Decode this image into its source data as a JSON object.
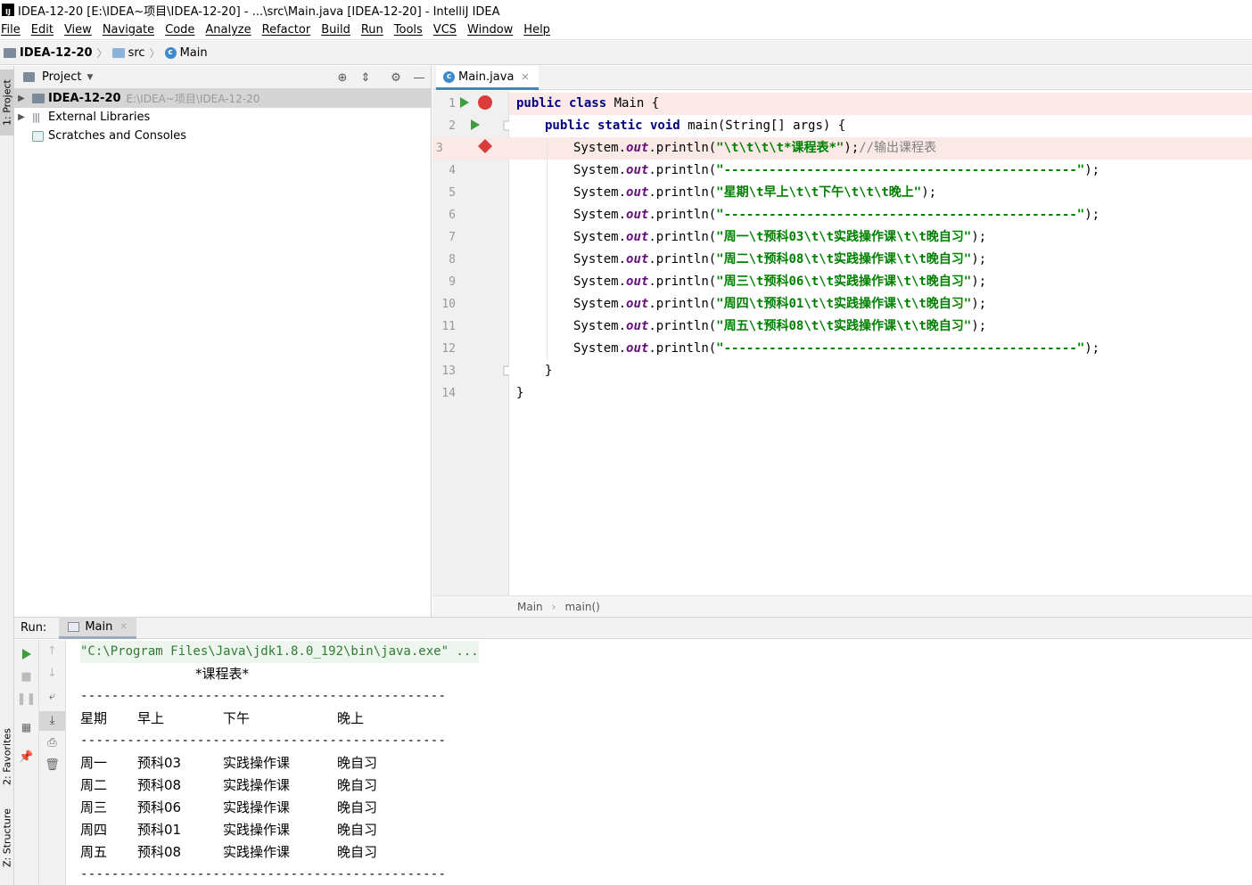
{
  "window": {
    "title": "IDEA-12-20 [E:\\IDEA~项目\\IDEA-12-20] - ...\\src\\Main.java [IDEA-12-20] - IntelliJ IDEA",
    "logo": "IJ"
  },
  "menu": [
    "File",
    "Edit",
    "View",
    "Navigate",
    "Code",
    "Analyze",
    "Refactor",
    "Build",
    "Run",
    "Tools",
    "VCS",
    "Window",
    "Help"
  ],
  "breadcrumb": {
    "project": "IDEA-12-20",
    "folder": "src",
    "file": "Main"
  },
  "side_tabs": {
    "project": "1: Project",
    "favorites": "2: Favorites",
    "structure": "Z: Structure"
  },
  "project_panel": {
    "title": "Project",
    "tree": [
      {
        "label": "IDEA-12-20",
        "path": "E:\\IDEA~项目\\IDEA-12-20",
        "selected": true
      },
      {
        "label": "External Libraries"
      },
      {
        "label": "Scratches and Consoles"
      }
    ]
  },
  "editor": {
    "tab": "Main.java",
    "line_numbers": [
      "1",
      "2",
      "3",
      "4",
      "5",
      "6",
      "7",
      "8",
      "9",
      "10",
      "11",
      "12",
      "13",
      "14"
    ],
    "lines": [
      {
        "kw": "public class ",
        "rest": "Main {"
      },
      {
        "kw": "public static void ",
        "rest": "main(String[] args) {"
      },
      {
        "pre": "System.",
        "field": "out",
        "mid": ".println(",
        "str": "\"\\t\\t\\t\\t*课程表*\"",
        "post": ");",
        "comment": "//输出课程表"
      },
      {
        "pre": "System.",
        "field": "out",
        "mid": ".println(",
        "str": "\"-----------------------------------------------\"",
        "post": ");"
      },
      {
        "pre": "System.",
        "field": "out",
        "mid": ".println(",
        "str": "\"星期\\t早上\\t\\t下午\\t\\t\\t晚上\"",
        "post": ");"
      },
      {
        "pre": "System.",
        "field": "out",
        "mid": ".println(",
        "str": "\"-----------------------------------------------\"",
        "post": ");"
      },
      {
        "pre": "System.",
        "field": "out",
        "mid": ".println(",
        "str": "\"周一\\t预科03\\t\\t实践操作课\\t\\t晚自习\"",
        "post": ");"
      },
      {
        "pre": "System.",
        "field": "out",
        "mid": ".println(",
        "str": "\"周二\\t预科08\\t\\t实践操作课\\t\\t晚自习\"",
        "post": ");"
      },
      {
        "pre": "System.",
        "field": "out",
        "mid": ".println(",
        "str": "\"周三\\t预科06\\t\\t实践操作课\\t\\t晚自习\"",
        "post": ");"
      },
      {
        "pre": "System.",
        "field": "out",
        "mid": ".println(",
        "str": "\"周四\\t预科01\\t\\t实践操作课\\t\\t晚自习\"",
        "post": ");"
      },
      {
        "pre": "System.",
        "field": "out",
        "mid": ".println(",
        "str": "\"周五\\t预科08\\t\\t实践操作课\\t\\t晚自习\"",
        "post": ");"
      },
      {
        "pre": "System.",
        "field": "out",
        "mid": ".println(",
        "str": "\"-----------------------------------------------\"",
        "post": ");"
      },
      {
        "rest": "}"
      },
      {
        "rest": "}"
      }
    ],
    "breadcrumb": {
      "cls": "Main",
      "method": "main()"
    }
  },
  "run": {
    "label": "Run:",
    "tab": "Main",
    "command": "\"C:\\Program Files\\Java\\jdk1.8.0_192\\bin\\java.exe\" ...",
    "title_line": "*课程表*",
    "divider": "-----------------------------------------------",
    "header": [
      "星期",
      "早上",
      "下午",
      "晚上"
    ],
    "rows": [
      [
        "周一",
        "预科03",
        "实践操作课",
        "晚自习"
      ],
      [
        "周二",
        "预科08",
        "实践操作课",
        "晚自习"
      ],
      [
        "周三",
        "预科06",
        "实践操作课",
        "晚自习"
      ],
      [
        "周四",
        "预科01",
        "实践操作课",
        "晚自习"
      ],
      [
        "周五",
        "预科08",
        "实践操作课",
        "晚自习"
      ]
    ]
  },
  "colors": {
    "keyword": "#000080",
    "string": "#008000",
    "field": "#660e7a",
    "comment": "#808080",
    "breakpoint": "#db3b3b",
    "run": "#3e9e3e",
    "accent": "#4083c9"
  }
}
